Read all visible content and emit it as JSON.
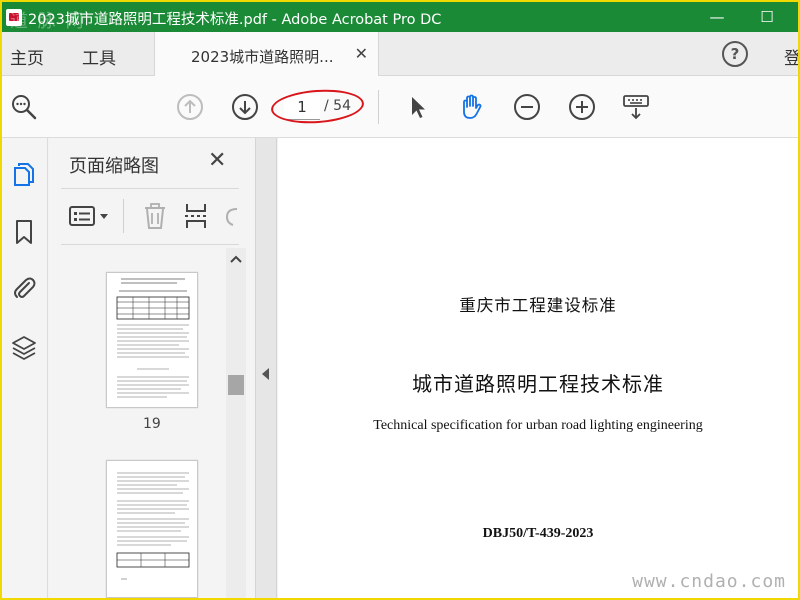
{
  "window": {
    "title": "2023城市道路照明工程技术标准.pdf - Adobe Acrobat Pro DC",
    "watermark_top_left": "道 脉 网",
    "minimize": "—",
    "maximize": "☐"
  },
  "menu": {
    "home": "主页",
    "tools": "工具",
    "doc_tab": "2023城市道路照明...",
    "doc_tab_close": "✕",
    "help": "?",
    "login": "登"
  },
  "toolbar": {
    "current_page": "1",
    "total_pages": "/ 54"
  },
  "thumbnail_panel": {
    "title": "页面缩略图",
    "close": "✕",
    "page_a": "19",
    "page_b": ""
  },
  "document": {
    "standard_line": "重庆市工程建设标准",
    "title": "城市道路照明工程技术标准",
    "english_title": "Technical specification for urban road lighting engineering",
    "code": "DBJ50/T-439-2023"
  },
  "watermark_bottom_right": "www.cndao.com",
  "colors": {
    "title_bar": "#1a8a36",
    "frame": "#f0d900",
    "annotation": "#d8161b",
    "hand_tool": "#1473e6"
  }
}
